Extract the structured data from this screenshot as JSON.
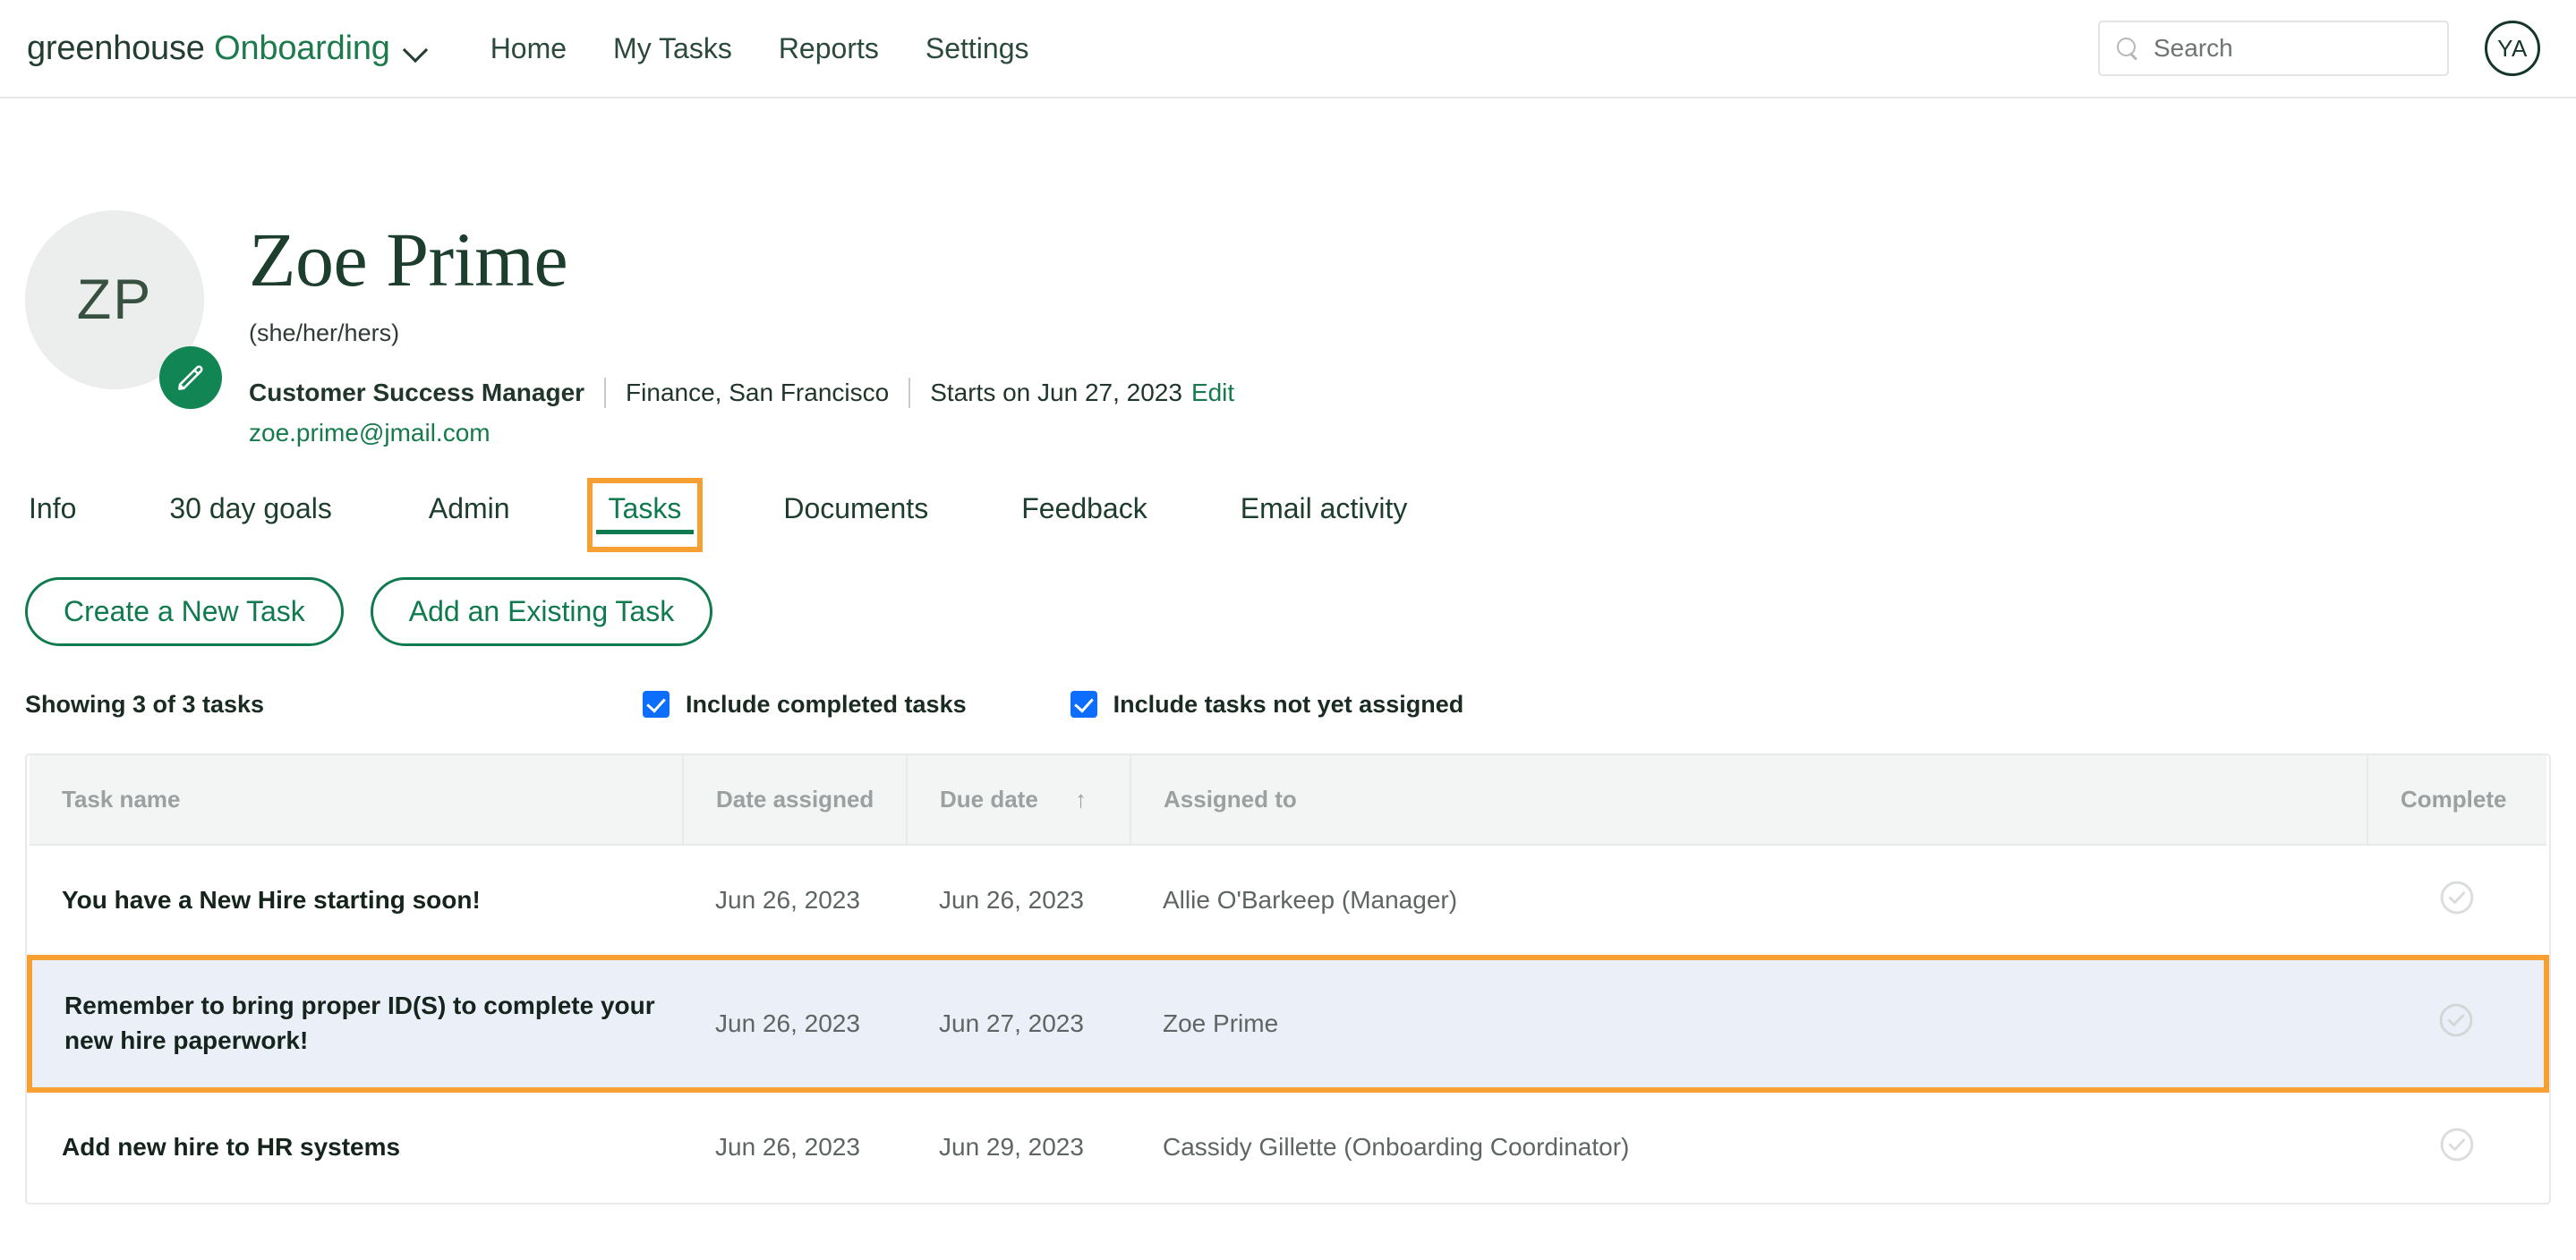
{
  "topbar": {
    "brand_dark": "greenhouse",
    "brand_green": "Onboarding",
    "nav_links": [
      {
        "label": "Home"
      },
      {
        "label": "My Tasks"
      },
      {
        "label": "Reports"
      },
      {
        "label": "Settings"
      }
    ],
    "search": {
      "value": "",
      "placeholder": "Search"
    },
    "user_initials": "YA",
    "chevron_icon": "chevron-down-icon",
    "search_icon": "search-icon"
  },
  "profile": {
    "avatar_initials": "ZP",
    "edit_icon": "pencil-icon",
    "name": "Zoe Prime",
    "pronouns": "(she/her/hers)",
    "job_title": "Customer Success Manager",
    "department_location": "Finance, San Francisco",
    "start_date": "Starts on Jun 27, 2023",
    "edit_label": "Edit",
    "email": "zoe.prime@jmail.com"
  },
  "tabs": [
    {
      "label": "Info",
      "active": false
    },
    {
      "label": "30 day goals",
      "active": false
    },
    {
      "label": "Admin",
      "active": false
    },
    {
      "label": "Tasks",
      "active": true
    },
    {
      "label": "Documents",
      "active": false
    },
    {
      "label": "Feedback",
      "active": false
    },
    {
      "label": "Email activity",
      "active": false
    }
  ],
  "actions": {
    "create_task_label": "Create a New Task",
    "add_existing_label": "Add an Existing Task"
  },
  "filters": {
    "showing_text": "Showing 3 of 3 tasks",
    "checkboxes": [
      {
        "label": "Include completed tasks",
        "checked": true
      },
      {
        "label": "Include tasks not yet assigned",
        "checked": true
      }
    ]
  },
  "table": {
    "columns": [
      {
        "label": "Task name"
      },
      {
        "label": "Date assigned"
      },
      {
        "label": "Due date",
        "sort": "↑"
      },
      {
        "label": "Assigned to"
      },
      {
        "label": "Complete"
      }
    ],
    "rows": [
      {
        "task_name": "You have a New Hire starting soon!",
        "date_assigned": "Jun 26, 2023",
        "due_date": "Jun 26, 2023",
        "assigned_to": "Allie O'Barkeep (Manager)",
        "complete_icon": "check-circle-icon",
        "highlighted": false
      },
      {
        "task_name": "Remember to bring proper ID(S) to complete your new hire paperwork!",
        "date_assigned": "Jun 26, 2023",
        "due_date": "Jun 27, 2023",
        "assigned_to": "Zoe Prime",
        "complete_icon": "check-circle-icon",
        "highlighted": true
      },
      {
        "task_name": "Add new hire to HR systems",
        "date_assigned": "Jun 26, 2023",
        "due_date": "Jun 29, 2023",
        "assigned_to": "Cassidy Gillette (Onboarding Coordinator)",
        "complete_icon": "check-circle-icon",
        "highlighted": false
      }
    ]
  },
  "colors": {
    "brand_green": "#0f7a4e",
    "dark_green": "#1d3d2d",
    "highlight_orange": "#f6a033",
    "highlight_row_bg": "#eaeff8",
    "checkbox_blue": "#0d6efd"
  }
}
